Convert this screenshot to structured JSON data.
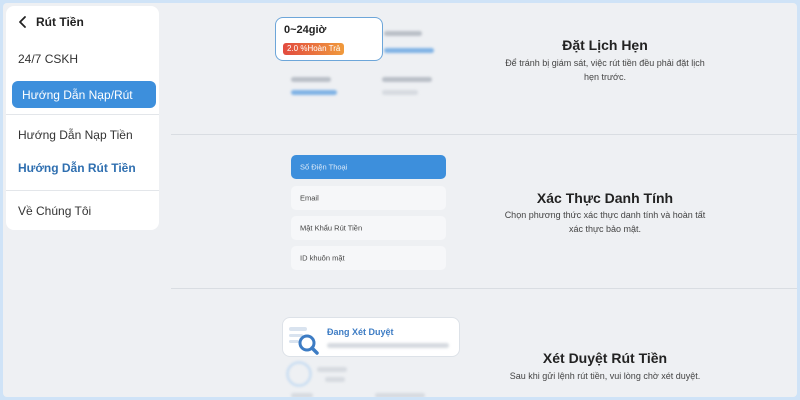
{
  "sidebar": {
    "title": "Rút Tiền",
    "items": [
      {
        "label": "24/7 CSKH"
      },
      {
        "label": "Hướng Dẫn Nạp/Rút"
      },
      {
        "label": "Hướng Dẫn Nạp Tiền"
      },
      {
        "label": "Hướng Dẫn Rút Tiền"
      },
      {
        "label": "Về Chúng Tôi"
      }
    ],
    "active_color": "#3d8fdc",
    "highlight_text_color": "#2f6fb0"
  },
  "section1": {
    "card_time": "0~24giờ",
    "card_fee": "2.0 %Hoàn Trả",
    "title": "Đặt Lịch Hẹn",
    "desc": "Để tránh bị giám sát, việc rút tiền đều phải đặt lịch hẹn trước."
  },
  "section2": {
    "options": [
      {
        "label": "Số Điện Thoại"
      },
      {
        "label": "Email"
      },
      {
        "label": "Mật Khẩu Rút Tiền"
      },
      {
        "label": "ID khuôn mặt"
      }
    ],
    "title": "Xác Thực Danh Tính",
    "desc": "Chọn phương thức xác thực danh tính và hoàn tất xác thực bảo mật."
  },
  "section3": {
    "card_title": "Đang Xét Duyệt",
    "title": "Xét Duyệt Rút Tiền",
    "desc": "Sau khi gửi lệnh rút tiền, vui lòng chờ xét duyệt."
  },
  "icons": {
    "back": "chevron-left-icon",
    "review": "magnifier-document-icon"
  },
  "colors": {
    "accent": "#3d8fdc",
    "fee_gradient_start": "#e24b3f",
    "fee_gradient_end": "#f09a3c"
  }
}
